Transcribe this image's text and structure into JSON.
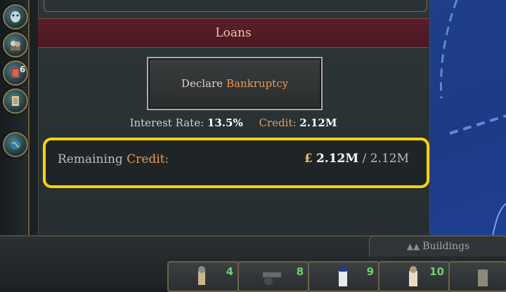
{
  "sidebar": {
    "badge_count": "6",
    "items": [
      {
        "icon": "mask-icon"
      },
      {
        "icon": "people-icon"
      },
      {
        "icon": "book-icon"
      },
      {
        "icon": "scroll-icon"
      },
      {
        "icon": "globe-icon"
      }
    ]
  },
  "loans": {
    "title": "Loans",
    "declare_label": "Declare",
    "declare_highlight": "Bankruptcy",
    "interest_label": "Interest Rate:",
    "interest_value": "13.5%",
    "credit_label": "Credit:",
    "credit_value": "2.12M",
    "remaining_label": "Remaining",
    "remaining_highlight": "Credit:",
    "currency_symbol": "£",
    "remaining_value": "2.12M",
    "remaining_total": "/ 2.12M"
  },
  "bottom": {
    "buildings_label": "Buildings",
    "units": [
      {
        "count": "4"
      },
      {
        "count": "8"
      },
      {
        "count": "9"
      },
      {
        "count": "10"
      }
    ]
  },
  "colors": {
    "highlight_border": "#f5d40a",
    "accent_orange": "#e69a5a",
    "loans_header": "#5a1f2a",
    "map_blue": "#1f3f8a"
  }
}
